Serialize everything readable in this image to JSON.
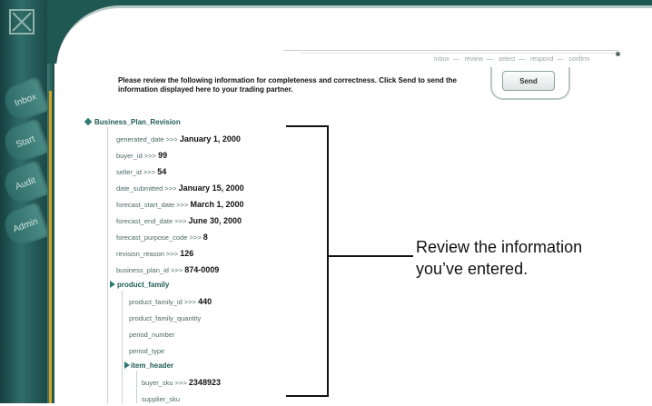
{
  "sidebar": {
    "tabs": [
      "Inbox",
      "Start",
      "Audit",
      "Admin"
    ]
  },
  "steps": [
    "inbox",
    "review",
    "select",
    "respond",
    "confirm"
  ],
  "instruction": "Please review the following information for completeness and correctness. Click Send to send the information displayed here to your trading partner.",
  "send_label": "Send",
  "tree": {
    "root": "Business_Plan_Revision",
    "fields": [
      {
        "label": "generated_date >>>",
        "value": "January 1, 2000"
      },
      {
        "label": "buyer_id >>>",
        "value": "99"
      },
      {
        "label": "seller_id >>>",
        "value": "54"
      },
      {
        "label": "date_submitted >>>",
        "value": "January 15, 2000"
      },
      {
        "label": "forecast_start_date >>>",
        "value": "March 1, 2000"
      },
      {
        "label": "forecast_end_date >>>",
        "value": "June 30, 2000"
      },
      {
        "label": "forecast_purpose_code >>>",
        "value": "8"
      },
      {
        "label": "revision_reason >>>",
        "value": "126"
      },
      {
        "label": "business_plan_id >>>",
        "value": "874-0009"
      }
    ],
    "product_family": {
      "label": "product_family",
      "fields": [
        {
          "label": "product_family_id >>>",
          "value": "440"
        },
        {
          "label": "product_family_quantity",
          "value": ""
        },
        {
          "label": "period_number",
          "value": ""
        },
        {
          "label": "period_type",
          "value": ""
        }
      ],
      "item_header": {
        "label": "item_header",
        "fields": [
          {
            "label": "buyer_sku >>>",
            "value": "2348923"
          },
          {
            "label": "supplier_sku",
            "value": ""
          }
        ]
      }
    }
  },
  "callout": "Review the information you’ve entered."
}
